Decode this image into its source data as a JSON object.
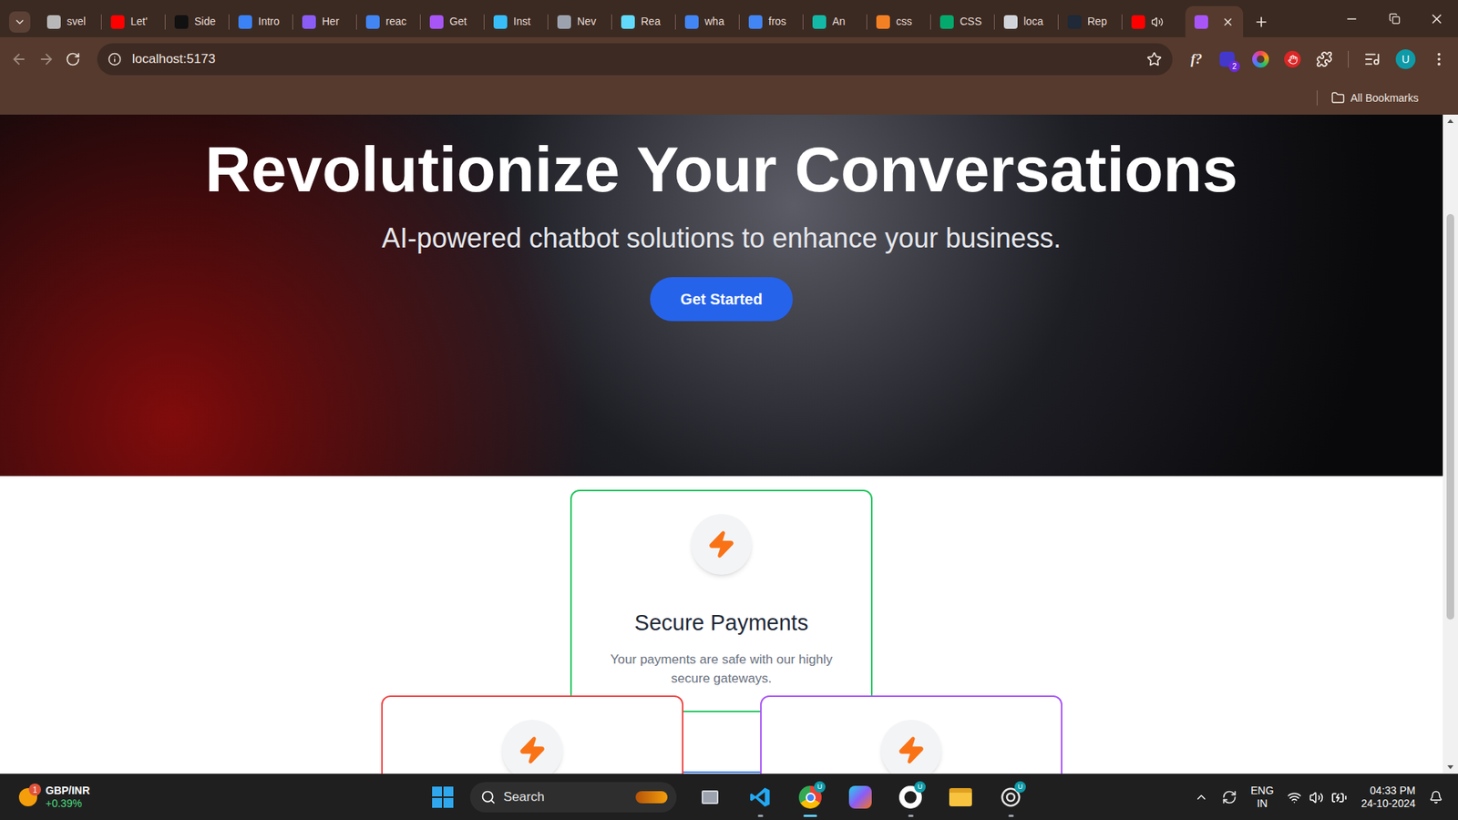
{
  "browser": {
    "tabs": [
      {
        "label": "svel",
        "selected": false,
        "audio": false,
        "color": "#b8b8b8"
      },
      {
        "label": "Let'",
        "selected": false,
        "audio": false,
        "color": "#ff0000"
      },
      {
        "label": "Side",
        "selected": false,
        "audio": false,
        "color": "#111111"
      },
      {
        "label": "Intro",
        "selected": false,
        "audio": false,
        "color": "#3b82f6"
      },
      {
        "label": "Her",
        "selected": false,
        "audio": false,
        "color": "#8b5cf6"
      },
      {
        "label": "reac",
        "selected": false,
        "audio": false,
        "color": "#4285f4"
      },
      {
        "label": "Get",
        "selected": false,
        "audio": false,
        "color": "#a855f7"
      },
      {
        "label": "Inst",
        "selected": false,
        "audio": false,
        "color": "#38bdf8"
      },
      {
        "label": "Nev",
        "selected": false,
        "audio": false,
        "color": "#9ca3af"
      },
      {
        "label": "Rea",
        "selected": false,
        "audio": false,
        "color": "#61dafb"
      },
      {
        "label": "wha",
        "selected": false,
        "audio": false,
        "color": "#4285f4"
      },
      {
        "label": "fros",
        "selected": false,
        "audio": false,
        "color": "#4285f4"
      },
      {
        "label": "An",
        "selected": false,
        "audio": false,
        "color": "#14b8a6"
      },
      {
        "label": "css",
        "selected": false,
        "audio": false,
        "color": "#f48024"
      },
      {
        "label": "CSS",
        "selected": false,
        "audio": false,
        "color": "#04aa6d"
      },
      {
        "label": "loca",
        "selected": false,
        "audio": false,
        "color": "#d1d5db"
      },
      {
        "label": "Rep",
        "selected": false,
        "audio": false,
        "color": "#1f2937"
      },
      {
        "label": "",
        "selected": false,
        "audio": true,
        "color": "#ff0000"
      },
      {
        "label": "",
        "selected": true,
        "audio": false,
        "color": "#a855f7"
      }
    ],
    "address": "localhost:5173",
    "extensions": {
      "fx": "f?",
      "badge": "2",
      "profile": "U"
    },
    "bookmarks": {
      "label": "All Bookmarks"
    }
  },
  "page": {
    "hero": {
      "title": "Revolutionize Your Conversations",
      "subtitle": "AI-powered chatbot solutions to enhance your business.",
      "button": "Get Started"
    },
    "cards": [
      {
        "title": "Secure Payments",
        "description": "Your payments are safe with our highly secure gateways.",
        "color": "#22c55e"
      }
    ],
    "lower_cards": [
      {
        "kind": "card",
        "color": "#ef4444"
      },
      {
        "kind": "edge",
        "color": "#3b82f6"
      },
      {
        "kind": "card",
        "color": "#a855f7"
      }
    ],
    "scrollbar": {
      "offset": 0.137,
      "extent": 0.64
    }
  },
  "taskbar": {
    "widget": {
      "badge": "1",
      "symbol": "GBP/INR",
      "change": "+0.39%"
    },
    "search": {
      "placeholder": "Search"
    },
    "apps": [
      {
        "running": false,
        "active": false,
        "badge": ""
      },
      {
        "running": true,
        "active": false,
        "badge": ""
      },
      {
        "running": true,
        "active": true,
        "badge": "U"
      },
      {
        "running": false,
        "active": false,
        "badge": ""
      },
      {
        "running": true,
        "active": false,
        "badge": "U"
      },
      {
        "running": false,
        "active": false,
        "badge": ""
      },
      {
        "running": true,
        "active": false,
        "badge": "U"
      }
    ],
    "tray": {
      "language": "ENG",
      "region": "IN",
      "time": "04:33 PM",
      "date": "24-10-2024"
    }
  }
}
